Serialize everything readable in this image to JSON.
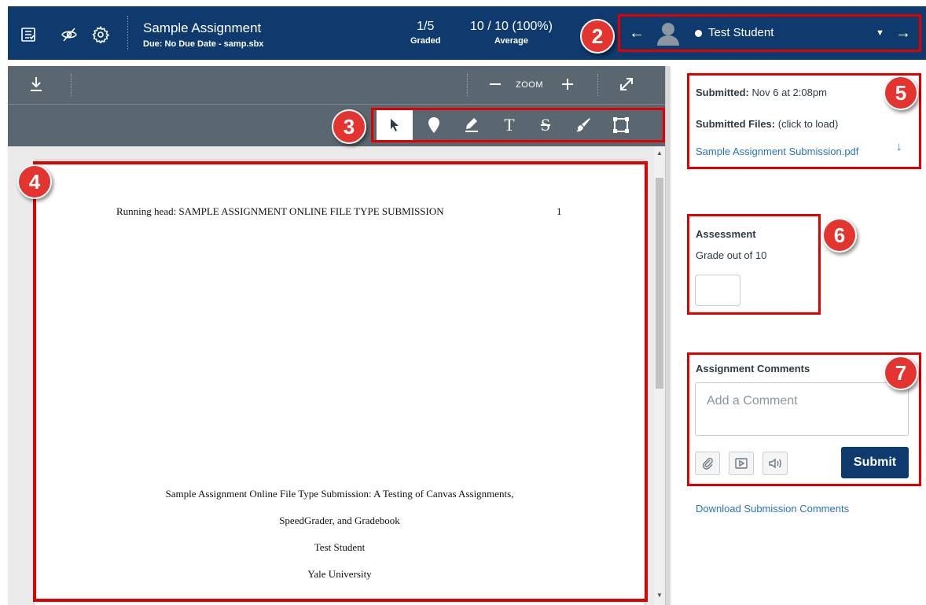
{
  "header": {
    "assignment_title": "Sample Assignment",
    "due_line": "Due: No Due Date - samp.sbx",
    "graded_value": "1/5",
    "graded_label": "Graded",
    "average_value": "10 / 10 (100%)",
    "average_label": "Average",
    "truncated_stat": "5",
    "student_name": "Test Student",
    "icons": [
      "gradebook-icon",
      "hide-eye-icon",
      "settings-gear-icon",
      "left-arrow-icon",
      "avatar-icon",
      "caret-down-icon",
      "right-arrow-icon"
    ]
  },
  "badges": [
    "2",
    "3",
    "4",
    "5",
    "6",
    "7"
  ],
  "viewer": {
    "zoom_label": "ZOOM",
    "tools": [
      "pointer-icon",
      "point-annotation-icon",
      "highlight-icon",
      "text-icon",
      "strikeout-icon",
      "freedraw-icon",
      "area-icon"
    ],
    "page": {
      "running_head": "Running head: SAMPLE ASSIGNMENT ONLINE FILE TYPE SUBMISSION",
      "page_number": "1",
      "title_line_1": "Sample Assignment Online File Type Submission: A Testing of Canvas Assignments,",
      "title_line_2": "SpeedGrader, and Gradebook",
      "author": "Test Student",
      "institution": "Yale University"
    }
  },
  "submission": {
    "submitted_label": "Submitted:",
    "submitted_date": "Nov 6 at 2:08pm",
    "files_label": "Submitted Files:",
    "files_hint": "(click to load)",
    "file_name": "Sample Assignment Submission.pdf"
  },
  "assessment": {
    "heading": "Assessment",
    "grade_label": "Grade out of 10"
  },
  "comments": {
    "heading": "Assignment Comments",
    "placeholder": "Add a Comment",
    "submit_label": "Submit",
    "download_link": "Download Submission Comments"
  },
  "colors": {
    "header_bg": "#0e3a6e",
    "toolbar_bg": "#5b6770",
    "highlight_border": "#e00000",
    "badge": "#e3342f",
    "link": "#2a73c2"
  }
}
